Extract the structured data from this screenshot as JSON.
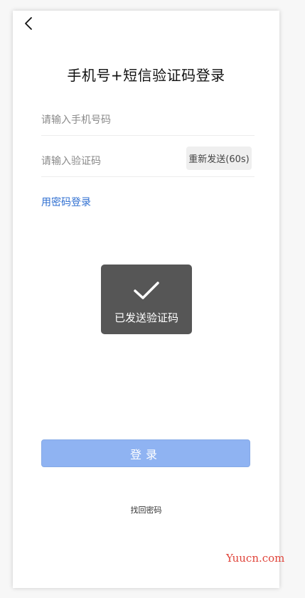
{
  "header": {
    "back_icon": "chevron-left-icon",
    "title": "手机号+短信验证码登录"
  },
  "form": {
    "phone_placeholder": "请输入手机号码",
    "code_placeholder": "请输入验证码",
    "resend_label": "重新发送(60s)",
    "password_login_link": "用密码登录"
  },
  "toast": {
    "icon": "checkmark-icon",
    "message": "已发送验证码"
  },
  "actions": {
    "login_label": "登录",
    "forgot_password": "找回密码"
  },
  "watermark": {
    "text": "Yuucn.com"
  },
  "colors": {
    "link": "#2f6fd1",
    "login_button": "#8fb3f2",
    "toast_bg": "#484848",
    "watermark": "#e0443a"
  }
}
